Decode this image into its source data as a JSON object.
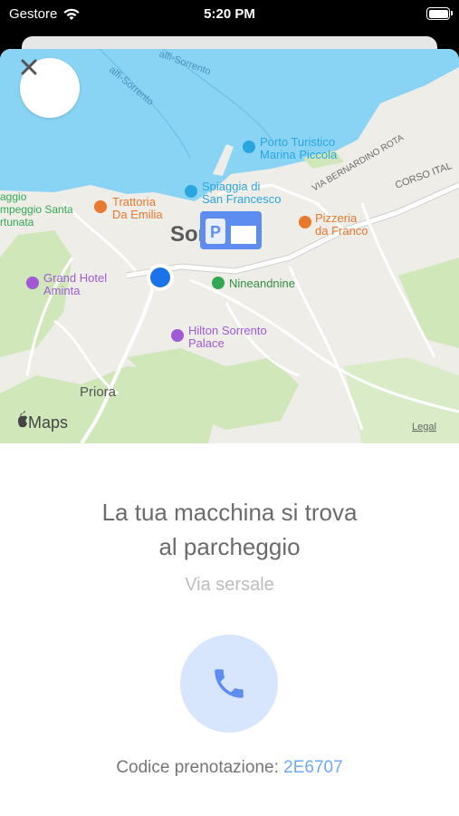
{
  "status_bar": {
    "carrier": "Gestore",
    "time": "5:20 PM"
  },
  "map": {
    "labels": {
      "town": "Sorrento",
      "port_line1": "Porto Turistico",
      "port_line2": "Marina Piccola",
      "beach_line1": "Spiaggia di",
      "beach_line2": "San Francesco",
      "trattoria_line1": "Trattoria",
      "trattoria_line2": "Da Emilia",
      "pizzeria_line1": "Pizzeria",
      "pizzeria_line2": "da Franco",
      "hotel_line1": "Grand Hotel",
      "hotel_line2": "Aminta",
      "shop": "Nineandnine",
      "hilton_line1": "Hilton Sorrento",
      "hilton_line2": "Palace",
      "priora": "Priora",
      "street1": "VIA BERNARDINO ROTA",
      "street2": "CORSO ITAL",
      "coast_road1": "alfi-Sorrento",
      "coast_road2": "alfi-Sorrento",
      "camp_line1": "aggio",
      "camp_line2": "mpeggio Santa",
      "camp_line3": "rtunata",
      "maps_brand": "Maps",
      "legal": "Legal"
    },
    "parking_label": "P",
    "colors": {
      "water": "#89d4f5",
      "land": "#eeede8",
      "green": "#cfe7b9",
      "road": "#ffffff",
      "poi_orange": "#e8792f",
      "poi_blue": "#2aa6df",
      "poi_purple": "#a05ad6",
      "poi_green": "#33a852",
      "user_dot": "#1a73e8"
    }
  },
  "info": {
    "title_line1": "La tua macchina si trova",
    "title_line2": "al parcheggio",
    "address": "Via sersale",
    "booking_label": "Codice prenotazione:",
    "booking_code": "2E6707"
  },
  "icons": {
    "close": "close-icon",
    "phone": "phone-icon",
    "wifi": "wifi-icon",
    "battery": "battery-icon"
  }
}
